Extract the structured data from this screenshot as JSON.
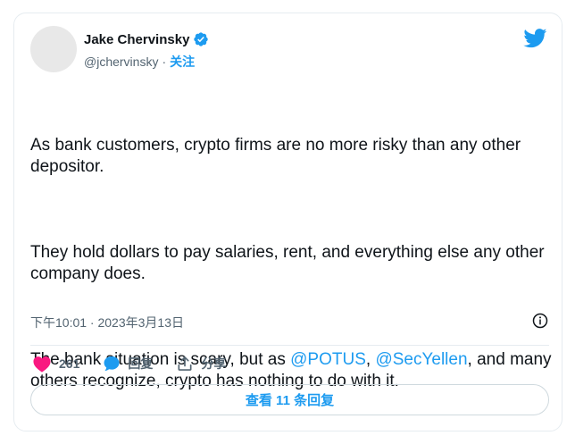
{
  "tweet": {
    "author": {
      "name": "Jake Chervinsky",
      "handle": "@jchervinsky",
      "separator": "·",
      "follow_label": "关注",
      "verified": true
    },
    "body": {
      "p1": "As bank customers, crypto firms are no more risky than any other depositor.",
      "p2": "They hold dollars to pay salaries, rent, and everything else any other company does.",
      "p3_start": "The bank situation is scary, but as ",
      "mention1": "@POTUS",
      "p3_comma": ", ",
      "mention2": "@SecYellen",
      "p3_end": ", and many others recognize, crypto has nothing to do with it."
    },
    "timestamp": "下午10:01 · 2023年3月13日",
    "actions": {
      "likes_count": "261",
      "reply_label": "回复",
      "share_label": "分享"
    },
    "view_replies_label": "查看 11 条回复"
  },
  "colors": {
    "accent": "#1d9bf0",
    "like": "#f91880",
    "muted_text": "#536471",
    "text": "#0f1419",
    "border": "#e6ecf0"
  },
  "icons": {
    "verified": "verified-badge-icon",
    "brand": "twitter-bird-icon",
    "info": "info-icon",
    "like": "heart-icon",
    "reply": "speech-bubble-icon",
    "share": "share-icon"
  }
}
